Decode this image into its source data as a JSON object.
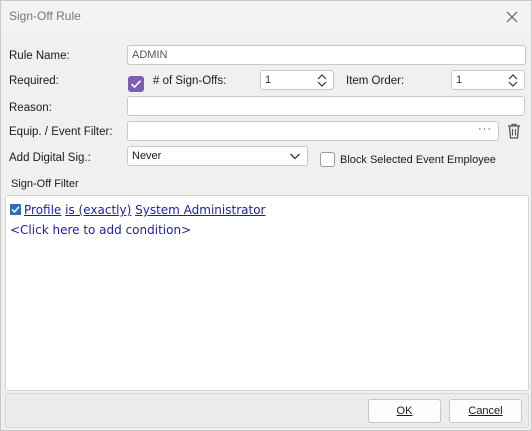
{
  "window": {
    "title": "Sign-Off Rule"
  },
  "form": {
    "rule_name_label": "Rule Name:",
    "rule_name_value": "ADMIN",
    "required_label": "Required:",
    "required_checked": true,
    "num_signoffs_label": "# of Sign-Offs:",
    "num_signoffs_value": "1",
    "item_order_label": "Item Order:",
    "item_order_value": "1",
    "reason_label": "Reason:",
    "reason_value": "",
    "equip_filter_label": "Equip. / Event Filter:",
    "equip_filter_value": "",
    "equip_filter_browse": "···",
    "add_digital_sig_label": "Add Digital Sig.:",
    "add_digital_sig_value": "Never",
    "block_selected_label": "Block Selected Event Employee",
    "block_selected_checked": false
  },
  "filter": {
    "section_label": "Sign-Off Filter",
    "condition": {
      "field": "Profile",
      "operator": "is (exactly)",
      "value": "System Administrator",
      "enabled": true
    },
    "add_condition": "<Click here to add condition>"
  },
  "footer": {
    "ok_label": "OK",
    "cancel_label": "Cancel"
  },
  "colors": {
    "accent_checkbox": "#7b5fb4",
    "condition_text": "#1f1fa0"
  },
  "icons": [
    "close-icon",
    "spin-arrows-icon",
    "checkmark-icon",
    "trash-icon",
    "chevron-down-icon"
  ]
}
